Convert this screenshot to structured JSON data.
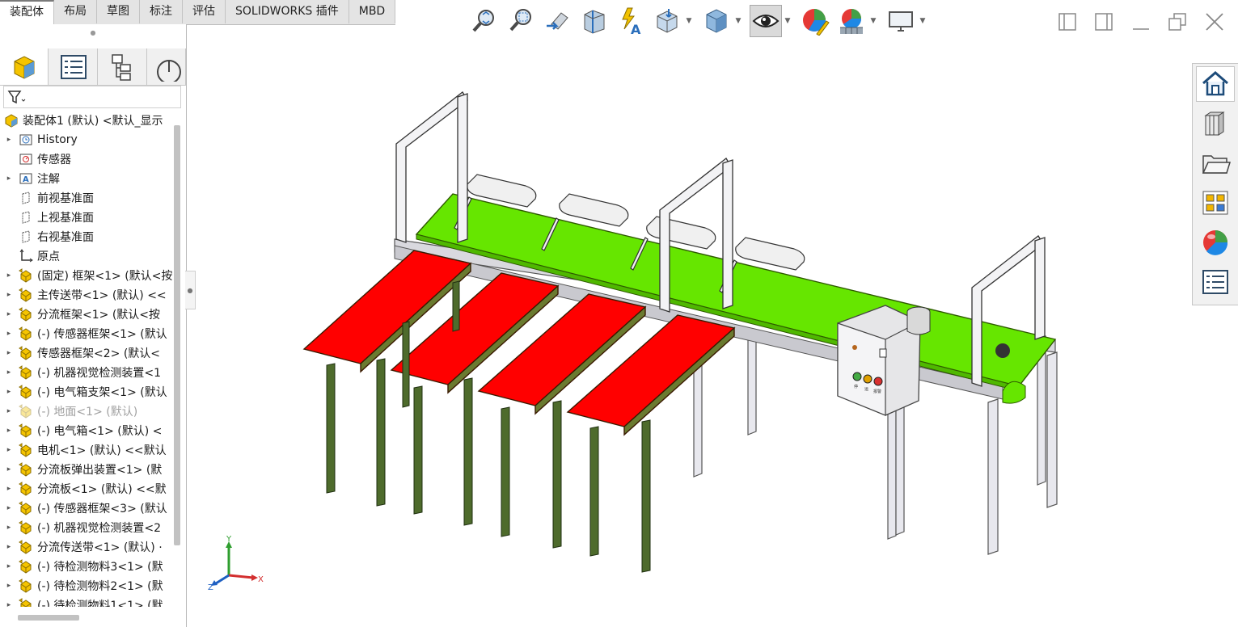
{
  "command_manager": {
    "tabs": [
      {
        "label": "装配体",
        "active": true
      },
      {
        "label": "布局"
      },
      {
        "label": "草图"
      },
      {
        "label": "标注"
      },
      {
        "label": "评估"
      },
      {
        "label": "SOLIDWORKS 插件"
      },
      {
        "label": "MBD"
      }
    ]
  },
  "heads_up_toolbar": {
    "buttons": [
      "zoom-to-fit-icon",
      "zoom-to-area-icon",
      "previous-view-icon",
      "section-view-icon",
      "dynamic-annotation-view-icon",
      "view-orientation-icon",
      "display-style-icon",
      "hide-show-items-icon",
      "edit-appearance-icon",
      "apply-scene-icon",
      "view-settings-icon"
    ]
  },
  "feature_manager": {
    "tree": [
      {
        "label": "装配体1 (默认) <默认_显示",
        "expand": false,
        "icon": "assembly-icon",
        "root": true
      },
      {
        "label": "History",
        "expand": true,
        "icon": "history-icon"
      },
      {
        "label": "传感器",
        "expand": false,
        "icon": "sensor-icon"
      },
      {
        "label": "注解",
        "expand": true,
        "icon": "annotation-icon"
      },
      {
        "label": "前视基准面",
        "expand": false,
        "icon": "plane-icon"
      },
      {
        "label": "上视基准面",
        "expand": false,
        "icon": "plane-icon"
      },
      {
        "label": "右视基准面",
        "expand": false,
        "icon": "plane-icon"
      },
      {
        "label": "原点",
        "expand": false,
        "icon": "origin-icon"
      },
      {
        "label": "(固定) 框架<1> (默认<按",
        "expand": true,
        "icon": "component-icon"
      },
      {
        "label": "主传送带<1> (默认) <<",
        "expand": true,
        "icon": "component-icon"
      },
      {
        "label": "分流框架<1> (默认<按",
        "expand": true,
        "icon": "component-icon"
      },
      {
        "label": "(-) 传感器框架<1> (默认",
        "expand": true,
        "icon": "component-icon"
      },
      {
        "label": "传感器框架<2> (默认<",
        "expand": true,
        "icon": "component-icon"
      },
      {
        "label": "(-) 机器视觉检测装置<1",
        "expand": true,
        "icon": "component-icon"
      },
      {
        "label": "(-) 电气箱支架<1> (默认",
        "expand": true,
        "icon": "component-icon"
      },
      {
        "label": "(-) 地面<1> (默认)",
        "expand": true,
        "icon": "component-icon",
        "dim": true
      },
      {
        "label": "(-) 电气箱<1> (默认) <",
        "expand": true,
        "icon": "component-icon"
      },
      {
        "label": "电机<1> (默认) <<默认",
        "expand": true,
        "icon": "component-icon"
      },
      {
        "label": "分流板弹出装置<1> (默",
        "expand": true,
        "icon": "component-icon"
      },
      {
        "label": "分流板<1> (默认) <<默",
        "expand": true,
        "icon": "component-icon"
      },
      {
        "label": "(-) 传感器框架<3> (默认",
        "expand": true,
        "icon": "component-icon"
      },
      {
        "label": "(-) 机器视觉检测装置<2",
        "expand": true,
        "icon": "component-icon"
      },
      {
        "label": "分流传送带<1> (默认) ·",
        "expand": true,
        "icon": "component-icon"
      },
      {
        "label": "(-) 待检测物料3<1> (默",
        "expand": true,
        "icon": "component-icon"
      },
      {
        "label": "(-) 待检测物料2<1> (默",
        "expand": true,
        "icon": "component-icon"
      },
      {
        "label": "(-) 待检测物料1<1> (默",
        "expand": true,
        "icon": "component-icon"
      }
    ]
  },
  "model": {
    "colors": {
      "main_belt": "#66e600",
      "branch_belt": "#ff0000",
      "frame": "#e8e8ee",
      "leg_dark": "#3f5a25"
    },
    "control_box_labels": [
      "停",
      "运",
      "报警"
    ]
  },
  "triad": {
    "x": "X",
    "y": "Y",
    "z": "Z"
  },
  "task_pane": {
    "buttons": [
      "home-icon",
      "design-library-icon",
      "file-explorer-icon",
      "view-palette-icon",
      "appearances-icon",
      "custom-properties-icon"
    ]
  }
}
